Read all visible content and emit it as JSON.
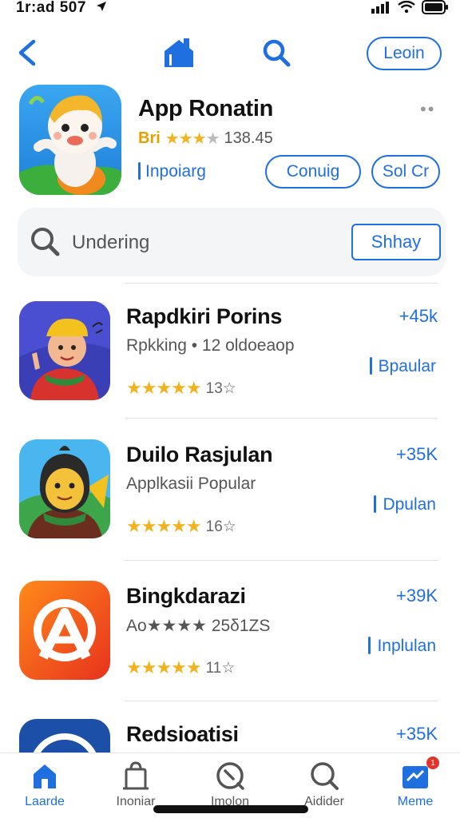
{
  "status_bar": {
    "time": "1r:ad 507"
  },
  "nav": {
    "login_label": "Leoin"
  },
  "featured": {
    "title": "App Ronatin",
    "more": "••",
    "rating_prefix": "Bri",
    "stars_text": "★★★",
    "stars_dim": "★",
    "rating_count": "138.45",
    "link_label": "Inpoiarg",
    "button_1": "Conuig",
    "button_2": "Sol Cr"
  },
  "search": {
    "text": "Undering",
    "button_label": "Shhay"
  },
  "apps": [
    {
      "name": "Rapdkiri Porins",
      "price": "+45k",
      "subtitle": "Rpkking • 12 oldoeaop",
      "link": "Bpaular",
      "stars": "★★★★★",
      "count": "13☆"
    },
    {
      "name": "Duilo Rasjulan",
      "price": "+35K",
      "subtitle": "Applkasii Popular",
      "link": "Dpulan",
      "stars": "★★★★★",
      "count": "16☆"
    },
    {
      "name": "Bingkdarazi",
      "price": "+39K",
      "subtitle": "Ao★★★★ 25δ1ZS",
      "link": "Inplulan",
      "stars": "★★★★★",
      "count": "11☆"
    },
    {
      "name": "Redsioatisi",
      "price": "+35K"
    }
  ],
  "tabs": [
    {
      "label": "Laarde",
      "icon": "home-icon",
      "active": true
    },
    {
      "label": "Inoniar",
      "icon": "bag-icon",
      "active": false
    },
    {
      "label": "Imolon",
      "icon": "compass-icon",
      "active": false
    },
    {
      "label": "Aidider",
      "icon": "search-icon",
      "active": false
    },
    {
      "label": "Meme",
      "icon": "inbox-icon",
      "active": true,
      "badge": "1"
    }
  ],
  "colors": {
    "accent": "#1f6fe0",
    "star": "#f2b21d",
    "badge": "#e5322b"
  }
}
